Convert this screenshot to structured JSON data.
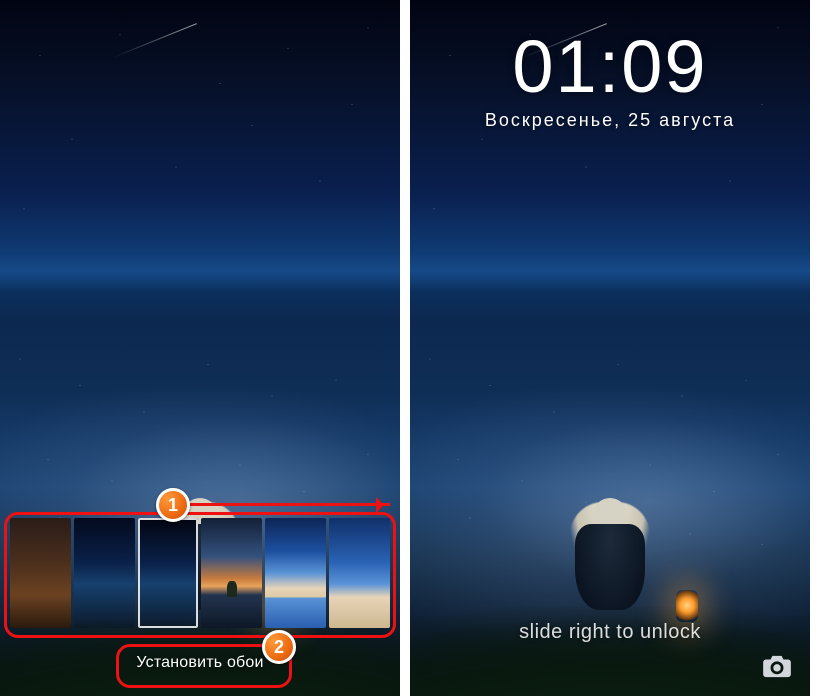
{
  "annotations": {
    "badge1": "1",
    "badge2": "2",
    "color": "#e11"
  },
  "left_screen": {
    "thumbnails": [
      {
        "name": "wallpaper-thumb-1",
        "selected": false
      },
      {
        "name": "wallpaper-thumb-2",
        "selected": false
      },
      {
        "name": "wallpaper-thumb-3",
        "selected": true
      },
      {
        "name": "wallpaper-thumb-4",
        "selected": false
      },
      {
        "name": "wallpaper-thumb-5",
        "selected": false
      },
      {
        "name": "wallpaper-thumb-6",
        "selected": false
      }
    ],
    "set_wallpaper_label": "Установить обои"
  },
  "right_screen": {
    "time": "01:09",
    "date": "Воскресенье, 25 августа",
    "unlock_hint": "slide right to unlock",
    "camera_icon": "camera-icon"
  }
}
